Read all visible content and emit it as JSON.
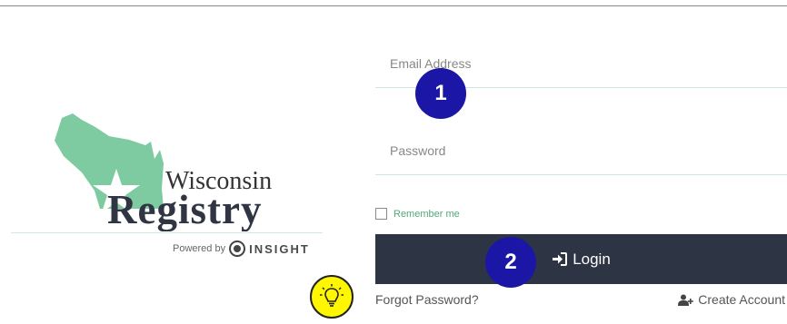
{
  "form": {
    "email_placeholder": "Email Address",
    "password_placeholder": "Password",
    "remember_label": "Remember me",
    "login_label": "Login",
    "forgot_label": "Forgot Password?",
    "create_label": "Create Account"
  },
  "branding": {
    "logo_text_top": "Wisconsin",
    "logo_text_bottom": "Registry",
    "powered_by": "Powered by",
    "insight": "INSIGHT"
  },
  "callouts": {
    "step1": "1",
    "step2": "2"
  },
  "icons": {
    "login": "sign-in-icon",
    "create": "user-plus-icon",
    "tip": "lightbulb-icon"
  },
  "colors": {
    "primary_button": "#2d3444",
    "badge": "#1b16a6",
    "tip": "#fff700",
    "state_green": "#7ecba1",
    "remember_green": "#54a876"
  }
}
